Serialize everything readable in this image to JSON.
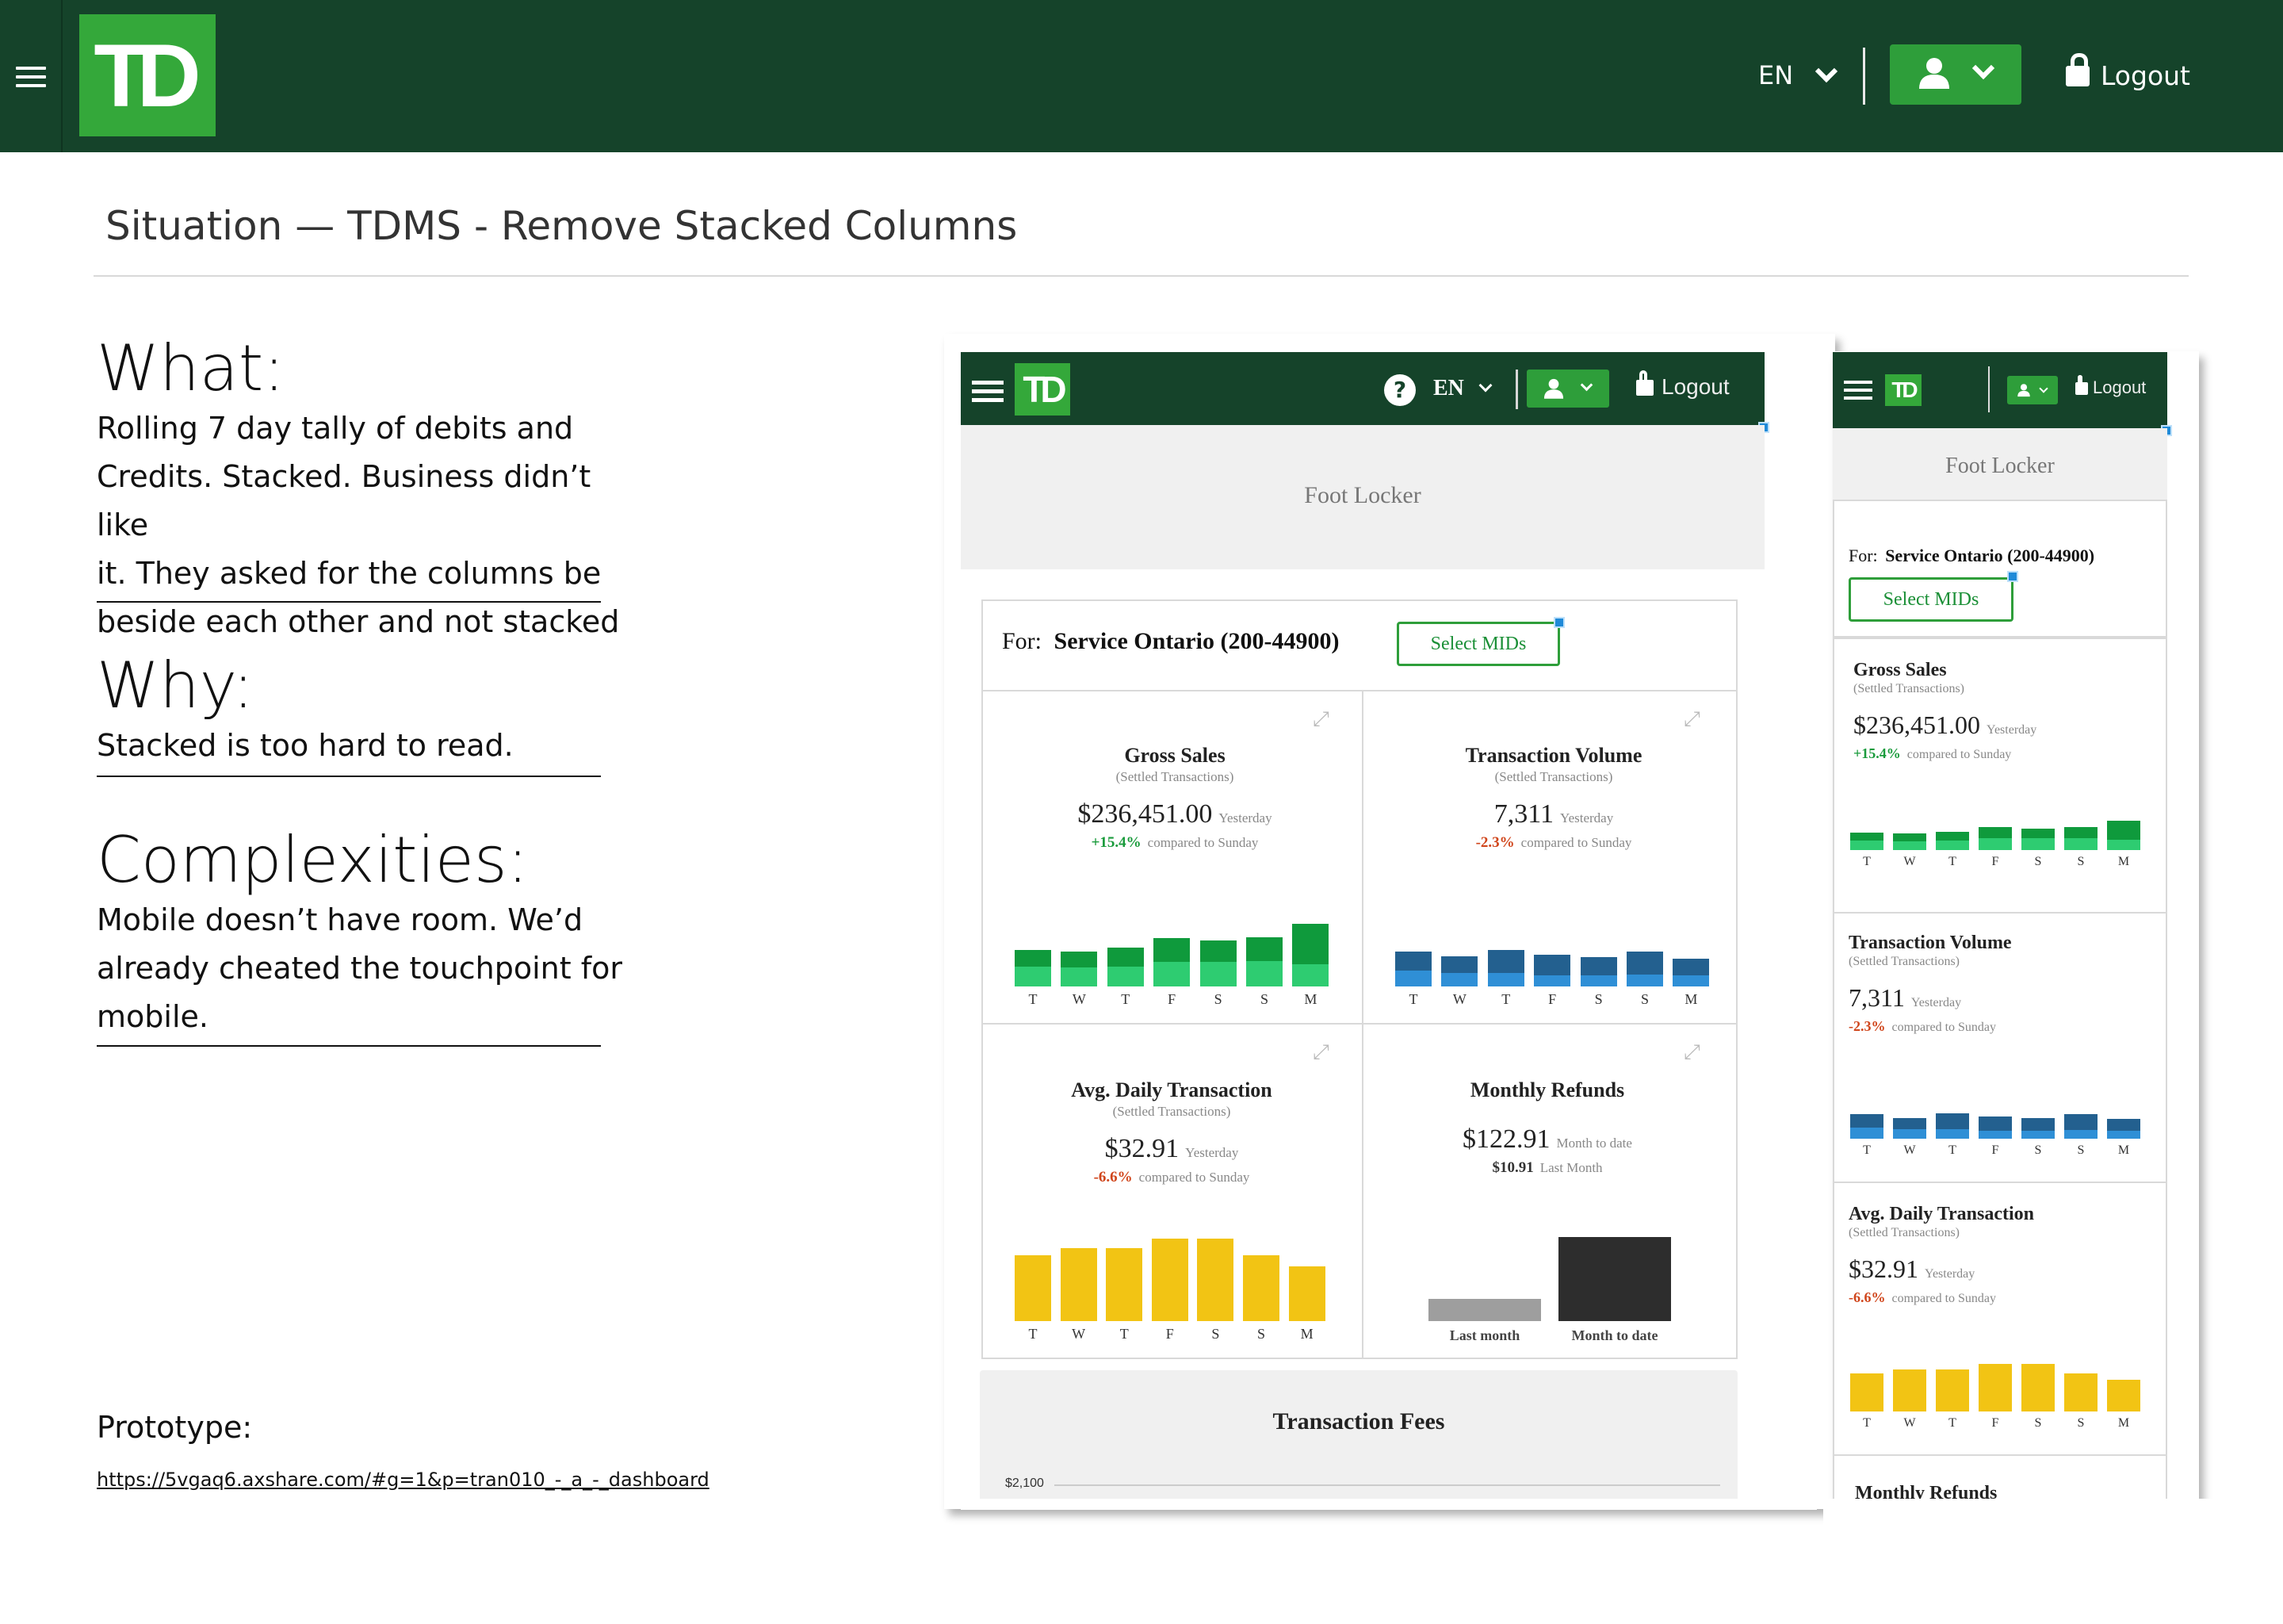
{
  "header": {
    "language": "EN",
    "logout_label": "Logout",
    "logo_text": "TD"
  },
  "page": {
    "title": "Situation — TDMS - Remove Stacked Columns"
  },
  "what": {
    "heading": "What:",
    "lines": [
      "Rolling 7 day tally of debits and",
      "Credits. Stacked. Business didn’t like",
      "it. They asked for the columns be",
      "beside each other and not stacked"
    ]
  },
  "why": {
    "heading": "Why:",
    "lines": [
      "Stacked is too hard to read."
    ]
  },
  "complexities": {
    "heading": "Complexities:",
    "lines": [
      "Mobile doesn’t have room. We’d",
      "already cheated the touchpoint for",
      "mobile."
    ]
  },
  "prototype": {
    "label": "Prototype:",
    "url": "https://5vgaq6.axshare.com/#g=1&p=tran010_-_a_-_dashboard"
  },
  "mock": {
    "help_icon": "?",
    "language": "EN",
    "logout_label": "Logout",
    "logo_text": "TD",
    "merchant": "Foot Locker",
    "for_label": "For:",
    "for_value": "Service Ontario (200-44900)",
    "select_mids": "Select MIDs",
    "days": [
      "T",
      "W",
      "T",
      "F",
      "S",
      "S",
      "M"
    ],
    "gross": {
      "title": "Gross Sales",
      "subtitle": "(Settled Transactions)",
      "value": "$236,451.00",
      "when": "Yesterday",
      "change": "+15.4%",
      "compare": "compared to Sunday",
      "color": "#1a9b3c"
    },
    "volume": {
      "title": "Transaction Volume",
      "subtitle": "(Settled Transactions)",
      "value": "7,311",
      "when": "Yesterday",
      "change": "-2.3%",
      "compare": "compared to Sunday",
      "color": "#d0451b"
    },
    "avg": {
      "title": "Avg. Daily Transaction",
      "subtitle": "(Settled Transactions)",
      "value": "$32.91",
      "when": "Yesterday",
      "change": "-6.6%",
      "compare": "compared to Sunday",
      "color": "#d0451b"
    },
    "refunds": {
      "title": "Monthly Refunds",
      "value": "$122.91",
      "when": "Month to date",
      "last_value": "$10.91",
      "last_when": "Last Month",
      "categories": [
        "Last month",
        "Month to date"
      ]
    },
    "fees": {
      "title": "Transaction Fees",
      "y_tick": "$2,100"
    },
    "mobile_refunds_title": "Monthly Refunds"
  },
  "colors": {
    "td_dark_green": "#15432a",
    "td_green": "#34a83a",
    "gross_dark": "#0f9a3c",
    "gross_light": "#2ecc71",
    "vol_dark": "#23608f",
    "vol_light": "#2f8fd6",
    "yellow": "#f2c414",
    "refund_light": "#9e9e9e",
    "refund_dark": "#2d2d2d"
  },
  "icons": [
    "menu-icon",
    "chevron-down-icon",
    "user-icon",
    "lock-icon",
    "help-icon",
    "expand-icon"
  ],
  "chart_data": [
    {
      "type": "bar",
      "title": "Gross Sales",
      "categories": [
        "T",
        "W",
        "T",
        "F",
        "S",
        "S",
        "M"
      ],
      "series": [
        {
          "values": [
            0.35,
            0.34,
            0.4,
            0.5,
            0.44,
            0.5,
            0.85
          ]
        },
        {
          "values": [
            0.42,
            0.4,
            0.42,
            0.52,
            0.52,
            0.53,
            0.46
          ]
        }
      ]
    },
    {
      "type": "bar",
      "title": "Transaction Volume",
      "categories": [
        "T",
        "W",
        "T",
        "F",
        "S",
        "S",
        "M"
      ],
      "series": [
        {
          "values": [
            0.6,
            0.52,
            0.72,
            0.65,
            0.58,
            0.73,
            0.52
          ]
        },
        {
          "values": [
            0.5,
            0.42,
            0.43,
            0.35,
            0.35,
            0.38,
            0.36
          ]
        }
      ]
    },
    {
      "type": "bar",
      "title": "Avg. Daily Transaction",
      "categories": [
        "T",
        "W",
        "T",
        "F",
        "S",
        "S",
        "M"
      ],
      "values": [
        0.8,
        0.88,
        0.88,
        1.0,
        1.0,
        0.8,
        0.66
      ]
    },
    {
      "type": "bar",
      "title": "Monthly Refunds",
      "categories": [
        "Last month",
        "Month to date"
      ],
      "values": [
        10.91,
        122.91
      ]
    }
  ]
}
